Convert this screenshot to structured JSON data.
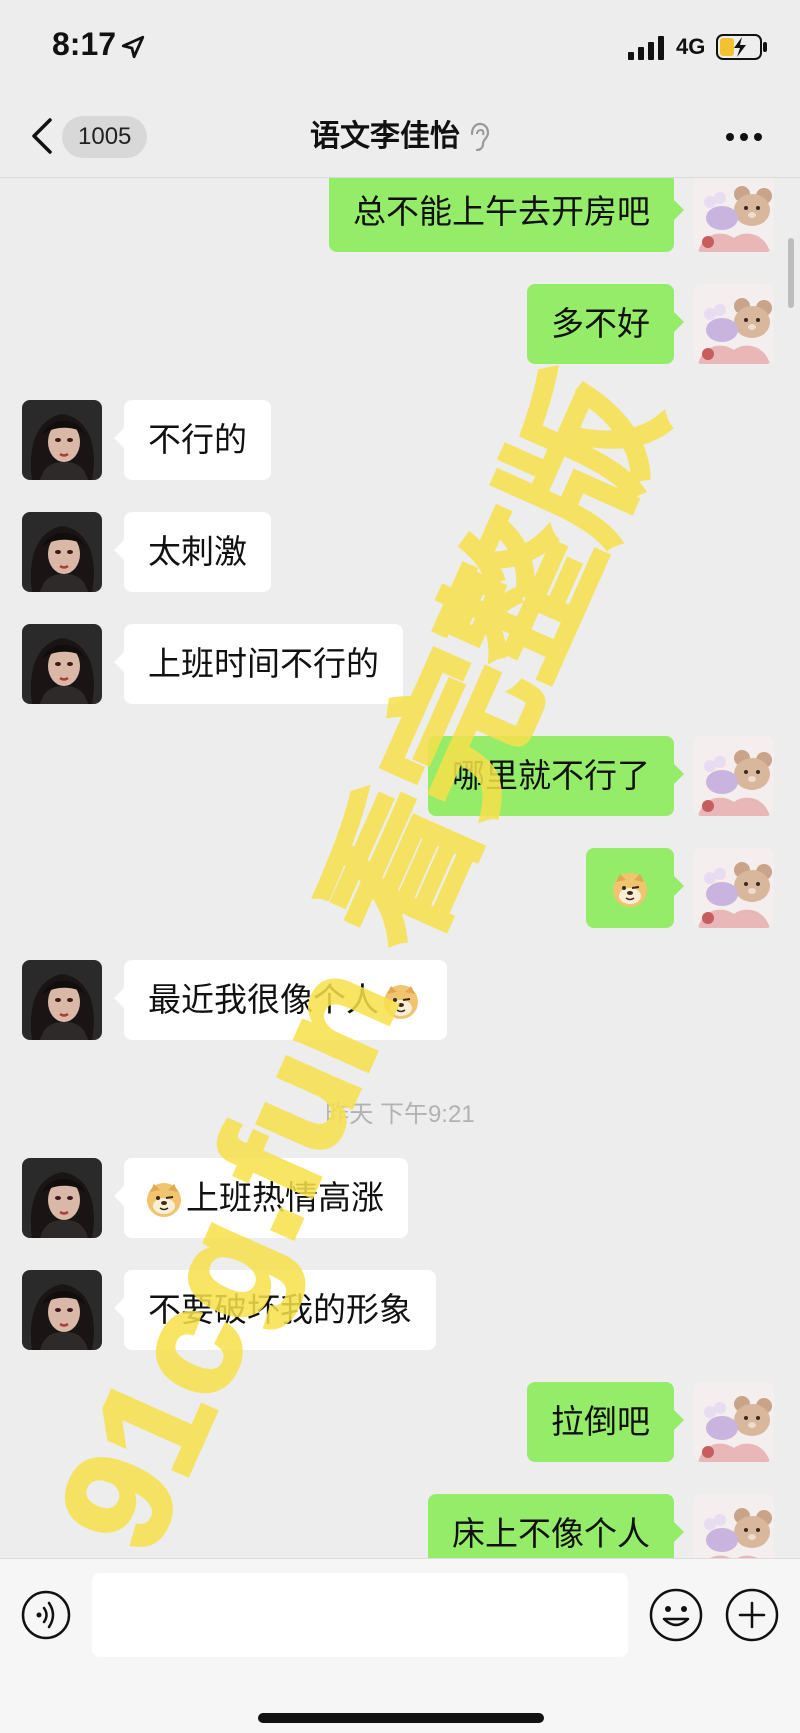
{
  "status_bar": {
    "time": "8:17",
    "network": "4G"
  },
  "nav": {
    "unread_count": "1005",
    "title": "语文李佳怡"
  },
  "messages": [
    {
      "side": "sent",
      "text": "总不能上午去开房吧"
    },
    {
      "side": "sent",
      "text": "多不好"
    },
    {
      "side": "recv",
      "text": "不行的"
    },
    {
      "side": "recv",
      "text": "太刺激"
    },
    {
      "side": "recv",
      "text": "上班时间不行的"
    },
    {
      "side": "sent",
      "text": "哪里就不行了"
    },
    {
      "side": "sent",
      "text": "",
      "emoji": "doge-emoji"
    },
    {
      "side": "recv",
      "text": "最近我很像个人",
      "emoji_after": "doge-emoji"
    },
    {
      "side": "recv",
      "text": "上班热情高涨",
      "emoji_before": "doge-emoji"
    },
    {
      "side": "recv",
      "text": "不要破坏我的形象"
    },
    {
      "side": "sent",
      "text": "拉倒吧"
    },
    {
      "side": "sent",
      "text": "床上不像个人"
    }
  ],
  "timestamp": "昨天 下午9:21",
  "input": {
    "value": "",
    "placeholder": ""
  },
  "watermark": {
    "text": "91cg.fun 看完整版",
    "color": "#f7e14a"
  },
  "colors": {
    "sent_bubble": "#95ec69",
    "recv_bubble": "#ffffff",
    "background": "#ededed"
  }
}
